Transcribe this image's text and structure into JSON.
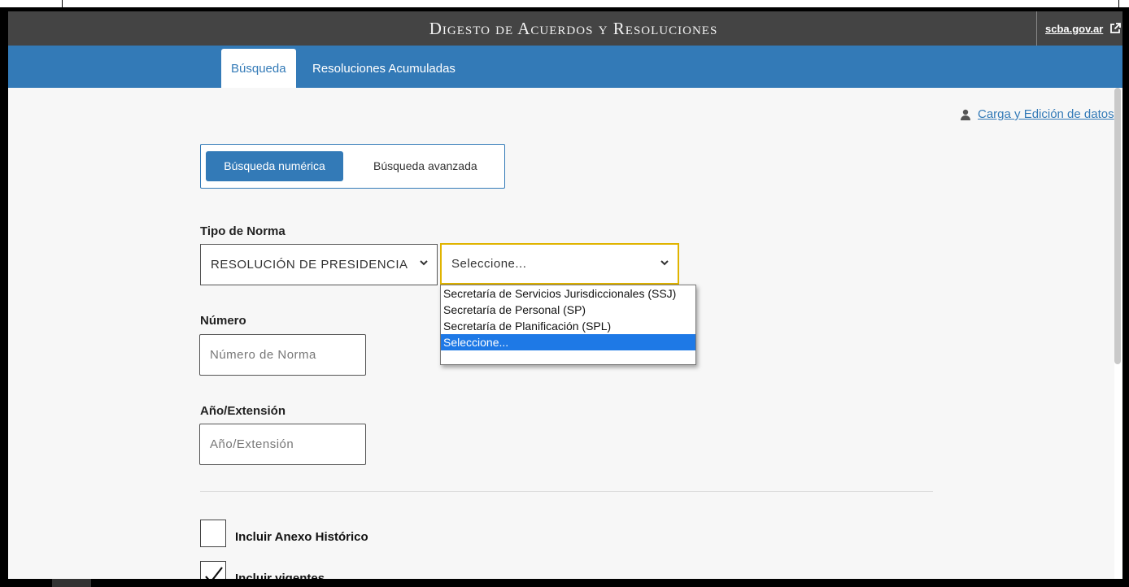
{
  "header": {
    "title": "Digesto de Acuerdos y Resoluciones",
    "external_link": "scba.gov.ar"
  },
  "nav": {
    "tabs": [
      {
        "label": "Búsqueda",
        "active": true
      },
      {
        "label": "Resoluciones Acumuladas",
        "active": false
      }
    ]
  },
  "user_link": "Carga y Edición de datos",
  "search_mode": {
    "numeric": "Búsqueda numérica",
    "advanced": "Búsqueda avanzada"
  },
  "form": {
    "tipo_label": "Tipo de Norma",
    "tipo_value": "RESOLUCIÓN DE PRESIDENCIA",
    "secretaria_value": "Seleccione...",
    "secretaria_options": [
      "Secretaría de Servicios Jurisdiccionales (SSJ)",
      "Secretaría de Personal (SP)",
      "Secretaría de Planificación (SPL)",
      "Seleccione..."
    ],
    "numero_label": "Número",
    "numero_placeholder": "Número de Norma",
    "anio_label": "Año/Extensión",
    "anio_placeholder": "Año/Extensión",
    "incluir_anexo": "Incluir Anexo Histórico",
    "incluir_anexo_checked": false,
    "incluir_vigentes": "Incluir vigentes",
    "incluir_vigentes_checked": true
  },
  "colors": {
    "primary": "#337ab7",
    "titlebar": "#444444",
    "focus": "#e0b400",
    "highlight": "#1e79e6"
  }
}
